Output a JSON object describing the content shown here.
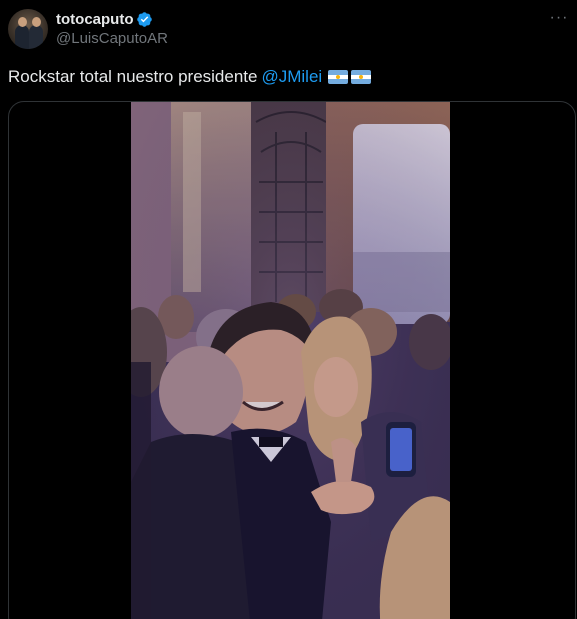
{
  "author": {
    "display_name": "totocaputo",
    "handle": "@LuisCaputoAR",
    "verified": true,
    "avatar_icon": "profile-photo"
  },
  "menu": {
    "more_label": "···"
  },
  "tweet": {
    "text": "Rockstar total nuestro presidente",
    "mention": "@JMilei",
    "emojis": [
      "argentina-flag",
      "argentina-flag"
    ]
  },
  "media": {
    "type": "video"
  },
  "colors": {
    "background": "#000000",
    "text": "#e7e9ea",
    "secondary_text": "#71767b",
    "link": "#1d9bf0",
    "verified_badge": "#1d9bf0",
    "border": "#2f3336"
  }
}
